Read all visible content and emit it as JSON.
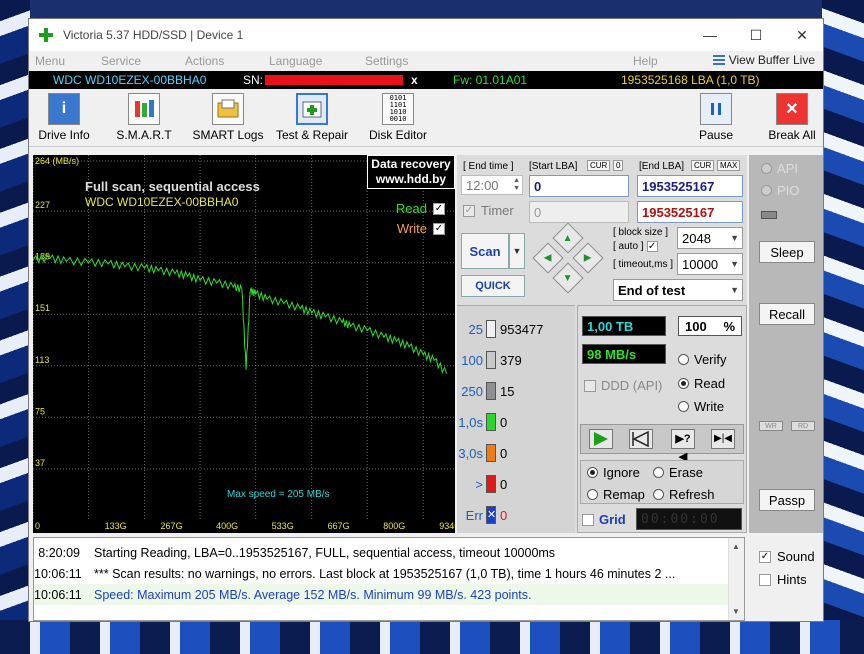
{
  "window": {
    "title": "Victoria 5.37 HDD/SSD | Device 1",
    "controls": {
      "minimize": "—",
      "maximize": "☐",
      "close": "✕"
    }
  },
  "menu": {
    "items": [
      "Menu",
      "Service",
      "Actions",
      "Language",
      "Settings",
      "Help"
    ],
    "view_buffer": "View Buffer Live"
  },
  "infobar": {
    "model": "WDC WD10EZEX-00BBHA0",
    "sn_label": "SN:",
    "sn_close": "x",
    "fw": "Fw: 01.01A01",
    "lba": "1953525168 LBA (1,0 TB)",
    "colors": {
      "model": "#4fd6ff",
      "fw": "#2fe02f",
      "lba": "#f2d21f"
    }
  },
  "toolbar": {
    "buttons": [
      "Drive Info",
      "S.M.A.R.T",
      "SMART Logs",
      "Test & Repair",
      "Disk Editor"
    ],
    "pause": "Pause",
    "break_all": "Break All"
  },
  "graph": {
    "legend_line1": "Data recovery",
    "legend_line2": "www.hdd.by",
    "title": "Full scan, sequential access",
    "subtitle": "WDC WD10EZEX-00BBHA0",
    "read_label": "Read",
    "write_label": "Write",
    "max_speed": "Max speed = 205 MB/s",
    "y_ticks": [
      "264 (MB/s)",
      "227",
      "189",
      "151",
      "113",
      "75",
      "37"
    ],
    "x_ticks": [
      "0",
      "133G",
      "267G",
      "400G",
      "533G",
      "667G",
      "800G",
      "934G"
    ]
  },
  "chart_data": {
    "type": "line",
    "title": "Full scan, sequential access",
    "subtitle": "WDC WD10EZEX-00BBHA0",
    "ylabel": "(MB/s)",
    "ylim": [
      0,
      264
    ],
    "x_tick_labels": [
      "0",
      "133G",
      "267G",
      "400G",
      "533G",
      "667G",
      "800G",
      "934G"
    ],
    "y_ticks": [
      37,
      75,
      113,
      151,
      189,
      227,
      264
    ],
    "series": [
      {
        "name": "Read",
        "x": [
          0,
          40,
          80,
          133,
          180,
          220,
          267,
          300,
          340,
          370,
          400,
          440,
          480,
          500,
          510,
          520,
          533,
          560,
          600,
          640,
          667,
          700,
          740,
          760,
          800,
          840,
          870,
          900,
          934,
          960,
          990
        ],
        "y": [
          191,
          192,
          190,
          189,
          188,
          186,
          185,
          183,
          181,
          179,
          176,
          174,
          171,
          169,
          110,
          168,
          166,
          162,
          159,
          155,
          152,
          149,
          145,
          142,
          139,
          134,
          131,
          127,
          121,
          117,
          107
        ]
      }
    ],
    "grid": true
  },
  "controls": {
    "end_time_label": "[ End time ]",
    "end_time": "12:00",
    "timer_label": "Timer",
    "timer_value": "0",
    "start_lba_label": "[Start LBA]",
    "start_lba_cur": "CUR",
    "start_lba_zero": "0",
    "start_lba": "0",
    "end_lba_label": "[End LBA]",
    "end_lba_cur": "CUR",
    "end_lba_max": "MAX",
    "end_lba": "1953525167",
    "end_lba2": "1953525167",
    "scan": "Scan",
    "quick": "QUICK",
    "block_size_label": "[ block size ]",
    "auto_label": "[ auto ]",
    "block_size": "2048",
    "timeout_label": "[ timeout,ms ]",
    "timeout": "10000",
    "mode": "End of test"
  },
  "stats": {
    "rows": [
      {
        "label": "25",
        "count": "953477",
        "color": "#f0f0f0"
      },
      {
        "label": "100",
        "count": "379",
        "color": "#c8c8c8"
      },
      {
        "label": "250",
        "count": "15",
        "color": "#909090"
      },
      {
        "label": "1,0s",
        "count": "0",
        "color": "#29d629"
      },
      {
        "label": "3,0s",
        "count": "0",
        "color": "#f07a14"
      },
      {
        "label": ">",
        "count": "0",
        "color": "#e01818"
      },
      {
        "label": "Err",
        "count": "0",
        "color": "#1a3fd0"
      }
    ]
  },
  "progress": {
    "size": "1,00 TB",
    "percent": "100",
    "percent_sign": "%",
    "speed": "98 MB/s",
    "ddd": "DDD (API)",
    "verify": "Verify",
    "read": "Read",
    "write": "Write",
    "ignore": "Ignore",
    "erase": "Erase",
    "remap": "Remap",
    "refresh": "Refresh",
    "grid": "Grid",
    "clock": "00:00:00"
  },
  "side": {
    "api": "API",
    "pio": "PIO",
    "sleep": "Sleep",
    "recall": "Recall",
    "wr": "WR",
    "rd": "RD",
    "passp": "Passp"
  },
  "log": {
    "rows": [
      {
        "time": "8:20:09",
        "text": "Starting Reading, LBA=0..1953525167, FULL, sequential access, timeout 10000ms",
        "color": "#000000",
        "bg": "#ffffff"
      },
      {
        "time": "10:06:11",
        "text": "*** Scan results: no warnings, no errors. Last block at 1953525167 (1,0 TB), time 1 hours 46 minutes 2 ...",
        "color": "#000000",
        "bg": "#ffffff"
      },
      {
        "time": "10:06:11",
        "text": "Speed: Maximum 205 MB/s. Average 152 MB/s. Minimum 99 MB/s. 423 points.",
        "color": "#1a3fd0",
        "bg": "#eef8e8"
      }
    ],
    "sound": "Sound",
    "hints": "Hints"
  }
}
